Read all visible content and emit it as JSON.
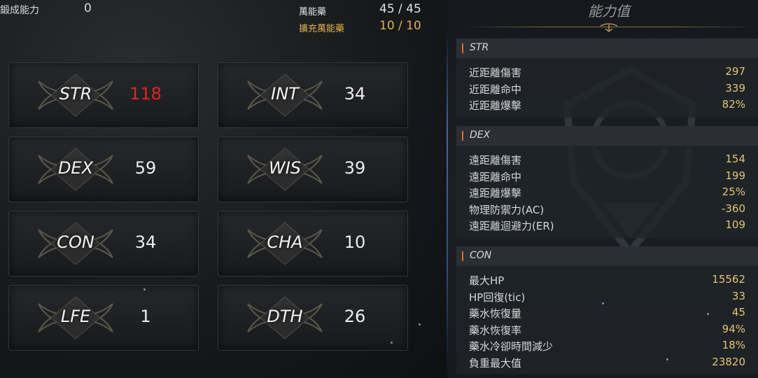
{
  "header": {
    "bonus_label": "鍛成能力",
    "bonus_value": "0",
    "elixir_label": "萬能藥",
    "elixir_value": "45 / 45",
    "ext_elixir_label": "擴充萬能藥",
    "ext_elixir_value": "10 / 10"
  },
  "stats": [
    {
      "name": "STR",
      "value": "118",
      "highlight": true
    },
    {
      "name": "INT",
      "value": "34"
    },
    {
      "name": "DEX",
      "value": "59"
    },
    {
      "name": "WIS",
      "value": "39"
    },
    {
      "name": "CON",
      "value": "34"
    },
    {
      "name": "CHA",
      "value": "10"
    },
    {
      "name": "LFE",
      "value": "1"
    },
    {
      "name": "DTH",
      "value": "26"
    }
  ],
  "panel": {
    "title": "能力值",
    "sections": [
      {
        "name": "STR",
        "rows": [
          {
            "label": "近距離傷害",
            "value": "297"
          },
          {
            "label": "近距離命中",
            "value": "339"
          },
          {
            "label": "近距離爆擊",
            "value": "82%"
          }
        ]
      },
      {
        "name": "DEX",
        "rows": [
          {
            "label": "遠距離傷害",
            "value": "154"
          },
          {
            "label": "遠距離命中",
            "value": "199"
          },
          {
            "label": "遠距離爆擊",
            "value": "25%"
          },
          {
            "label": "物理防禦力(AC)",
            "value": "-360"
          },
          {
            "label": "遠距離迴避力(ER)",
            "value": "109"
          }
        ]
      },
      {
        "name": "CON",
        "rows": [
          {
            "label": "最大HP",
            "value": "15562"
          },
          {
            "label": "HP回復(tic)",
            "value": "33"
          },
          {
            "label": "藥水恢復量",
            "value": "45"
          },
          {
            "label": "藥水恢復率",
            "value": "94%"
          },
          {
            "label": "藥水冷卻時間減少",
            "value": "18%"
          },
          {
            "label": "負重最大值",
            "value": "23820"
          }
        ]
      }
    ]
  },
  "colors": {
    "accent_gold": "#e0b14a",
    "highlight_red": "#e02424",
    "value_gold": "#e3c472",
    "section_bar": "#e46a2a"
  }
}
